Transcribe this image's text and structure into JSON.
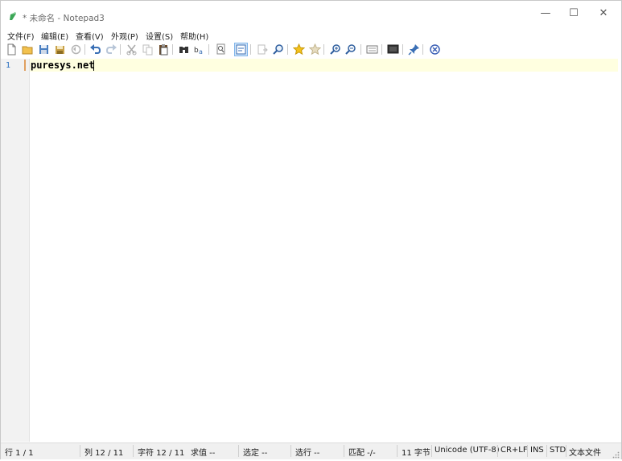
{
  "window": {
    "title": "* 未命名 - Notepad3"
  },
  "controls": {
    "minimize": "—",
    "maximize": "☐",
    "close": "✕"
  },
  "menu": [
    {
      "label": "文件(F)"
    },
    {
      "label": "编辑(E)"
    },
    {
      "label": "查看(V)"
    },
    {
      "label": "外观(P)"
    },
    {
      "label": "设置(S)"
    },
    {
      "label": "帮助(H)"
    }
  ],
  "toolbar": [
    {
      "icon": "new-file-icon"
    },
    {
      "icon": "open-folder-icon"
    },
    {
      "icon": "save-icon"
    },
    {
      "icon": "save-as-icon"
    },
    {
      "icon": "revert-icon"
    },
    {
      "icon": "undo-icon"
    },
    {
      "icon": "redo-icon"
    },
    {
      "icon": "cut-icon"
    },
    {
      "icon": "copy-icon"
    },
    {
      "icon": "paste-icon"
    },
    {
      "icon": "find-icon"
    },
    {
      "icon": "replace-icon"
    },
    {
      "icon": "find-in-files-icon"
    },
    {
      "icon": "word-wrap-icon"
    },
    {
      "icon": "goto-icon"
    },
    {
      "icon": "search-icon"
    },
    {
      "icon": "favorite-icon"
    },
    {
      "icon": "add-favorite-icon"
    },
    {
      "icon": "zoom-in-icon"
    },
    {
      "icon": "zoom-out-icon"
    },
    {
      "icon": "schemes-icon"
    },
    {
      "icon": "customize-icon"
    },
    {
      "icon": "pin-icon"
    },
    {
      "icon": "exit-icon"
    }
  ],
  "editor": {
    "line_number": "1",
    "line_text": "puresys.net"
  },
  "status": {
    "line": "行 1 / 1",
    "column": "列 12 / 11",
    "chars": "字符 12 / 11",
    "sum": "求值 --",
    "selection": "选定 --",
    "selected_lines": "选行 --",
    "match": "匹配 -/-",
    "bytes": "11 字节",
    "encoding": "Unicode (UTF-8)",
    "eol": "CR+LF",
    "ovr": "INS",
    "mode": "STD",
    "filetype": "文本文件"
  },
  "colors": {
    "accent": "#2a6fbf",
    "current_line": "#ffffe0"
  }
}
